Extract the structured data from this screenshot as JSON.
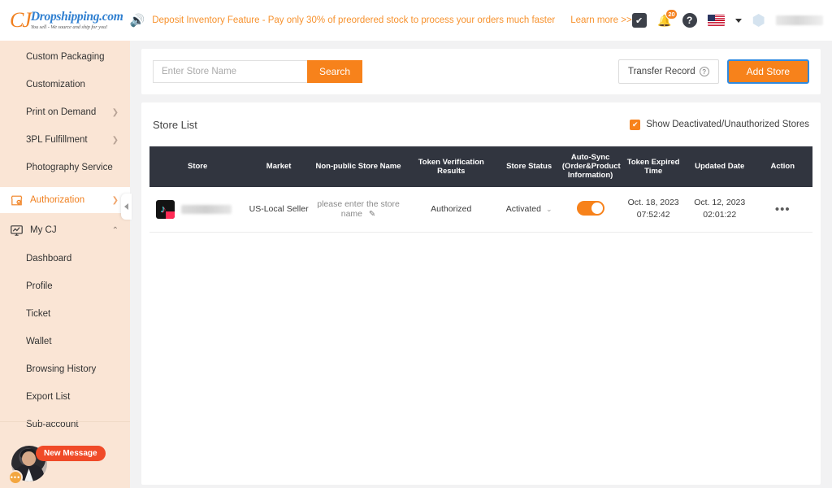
{
  "brand": {
    "monogram": "CJ",
    "name": "Dropshipping.com",
    "tagline": "You sell - We source and ship for you!"
  },
  "announcement": {
    "icon": "speaker-icon",
    "text": "Deposit Inventory Feature - Pay only 30% of preordered stock to process your orders much faster",
    "link_label": "Learn more >>"
  },
  "topbar_icons": {
    "tasks": "task-square-icon",
    "notifications": "bell-icon",
    "notification_count": "20",
    "help": "help-icon",
    "language_flag": "us-flag-icon",
    "language_caret": "chevron-down-icon",
    "account_avatar": "hexagon-avatar-icon",
    "account_name_masked": ""
  },
  "sidebar": {
    "items": [
      {
        "label": "Custom Packaging",
        "type": "sub",
        "has_chevron": false,
        "active": false
      },
      {
        "label": "Customization",
        "type": "sub",
        "has_chevron": false,
        "active": false
      },
      {
        "label": "Print on Demand",
        "type": "sub",
        "has_chevron": true,
        "active": false
      },
      {
        "label": "3PL Fulfillment",
        "type": "sub",
        "has_chevron": true,
        "active": false
      },
      {
        "label": "Photography Service",
        "type": "sub",
        "has_chevron": false,
        "active": false
      },
      {
        "label": "Authorization",
        "type": "group",
        "icon": "store-authorization-icon",
        "has_chevron": true,
        "active": true
      },
      {
        "label": "My CJ",
        "type": "group",
        "icon": "my-cj-monitor-icon",
        "has_chevron_up": true,
        "active": false
      },
      {
        "label": "Dashboard",
        "type": "sub",
        "has_chevron": false,
        "active": false
      },
      {
        "label": "Profile",
        "type": "sub",
        "has_chevron": false,
        "active": false
      },
      {
        "label": "Ticket",
        "type": "sub",
        "has_chevron": false,
        "active": false
      },
      {
        "label": "Wallet",
        "type": "sub",
        "has_chevron": false,
        "active": false
      },
      {
        "label": "Browsing History",
        "type": "sub",
        "has_chevron": false,
        "active": false
      },
      {
        "label": "Export List",
        "type": "sub",
        "has_chevron": false,
        "active": false
      },
      {
        "label": "Sub-account",
        "type": "sub",
        "has_chevron": false,
        "active": false
      }
    ],
    "collapse_tab": "collapse-sidebar-icon",
    "chat": {
      "badge_label": "New Message",
      "status_dots": "•••"
    }
  },
  "search": {
    "placeholder": "Enter Store Name",
    "value": "",
    "button_label": "Search"
  },
  "toolbar": {
    "transfer_record_label": "Transfer Record",
    "transfer_help_icon": "question-mark-icon",
    "add_store_label": "Add Store"
  },
  "store_list": {
    "title": "Store List",
    "show_deactivated_label": "Show Deactivated/Unauthorized Stores",
    "show_deactivated_checked": true,
    "columns": [
      "Store",
      "Market",
      "Non-public Store Name",
      "Token Verification Results",
      "Store Status",
      "Auto-Sync (Order&Product Information)",
      "Token Expired Time",
      "Updated Date",
      "Action"
    ],
    "auto_sync_header": {
      "line1": "Auto-Sync",
      "line2": "(Order&Product",
      "line3": "Information)"
    },
    "rows": [
      {
        "store_icon": "tiktok-logo-icon",
        "store_name_masked": "",
        "market": "US-Local Seller",
        "non_public_store_name": "please enter the store name",
        "edit_icon": "pencil-edit-icon",
        "token_verification": "Authorized",
        "store_status": "Activated",
        "status_caret": "chevron-down-icon",
        "auto_sync_on": true,
        "token_expired_date": "Oct. 18, 2023",
        "token_expired_time": "07:52:42",
        "updated_date": "Oct. 12, 2023",
        "updated_time": "02:01:22",
        "action": "•••"
      }
    ]
  },
  "colors": {
    "accent_orange": "#f7821b",
    "sidebar_bg": "#fae5d5",
    "table_header_bg": "#31353f",
    "brand_blue": "#2f7fd0",
    "focus_blue": "#2f8ae0",
    "new_message_red": "#f04a28"
  }
}
